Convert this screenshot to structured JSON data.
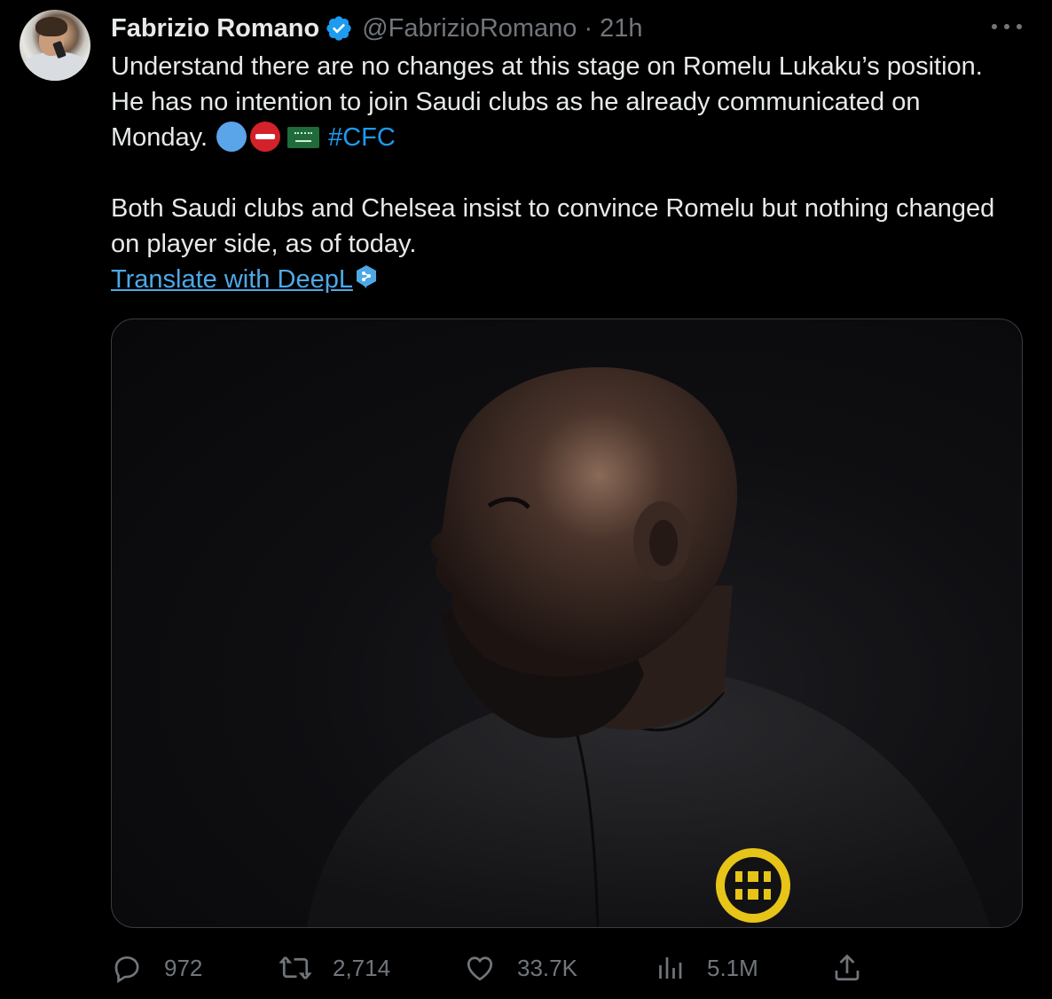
{
  "tweet": {
    "author_name": "Fabrizio Romano",
    "handle": "@FabrizioRomano",
    "separator": "·",
    "time": "21h",
    "paragraph1": "Understand there are no changes at this stage on Romelu Lukaku’s position. He has no intention to join Saudi clubs as he already communicated on Monday.",
    "emojis": [
      "blue-circle",
      "no-entry",
      "saudi-flag"
    ],
    "hashtag": "#CFC",
    "paragraph2": "Both Saudi clubs and Chelsea insist to convince Romelu but nothing changed on player side, as of today.",
    "translate_link": "Translate with DeepL"
  },
  "metrics": {
    "replies": "972",
    "retweets": "2,714",
    "likes": "33.7K",
    "views": "5.1M"
  },
  "icons": {
    "verified": "verified-badge-icon",
    "more": "more-icon",
    "reply": "reply-icon",
    "retweet": "retweet-icon",
    "like": "like-icon",
    "views": "views-icon",
    "share": "share-icon",
    "deepl": "deepl-icon"
  },
  "colors": {
    "background": "#000000",
    "text": "#e7e9ea",
    "muted": "#71767b",
    "link": "#1d9bf0",
    "verified": "#1d9bf0"
  }
}
